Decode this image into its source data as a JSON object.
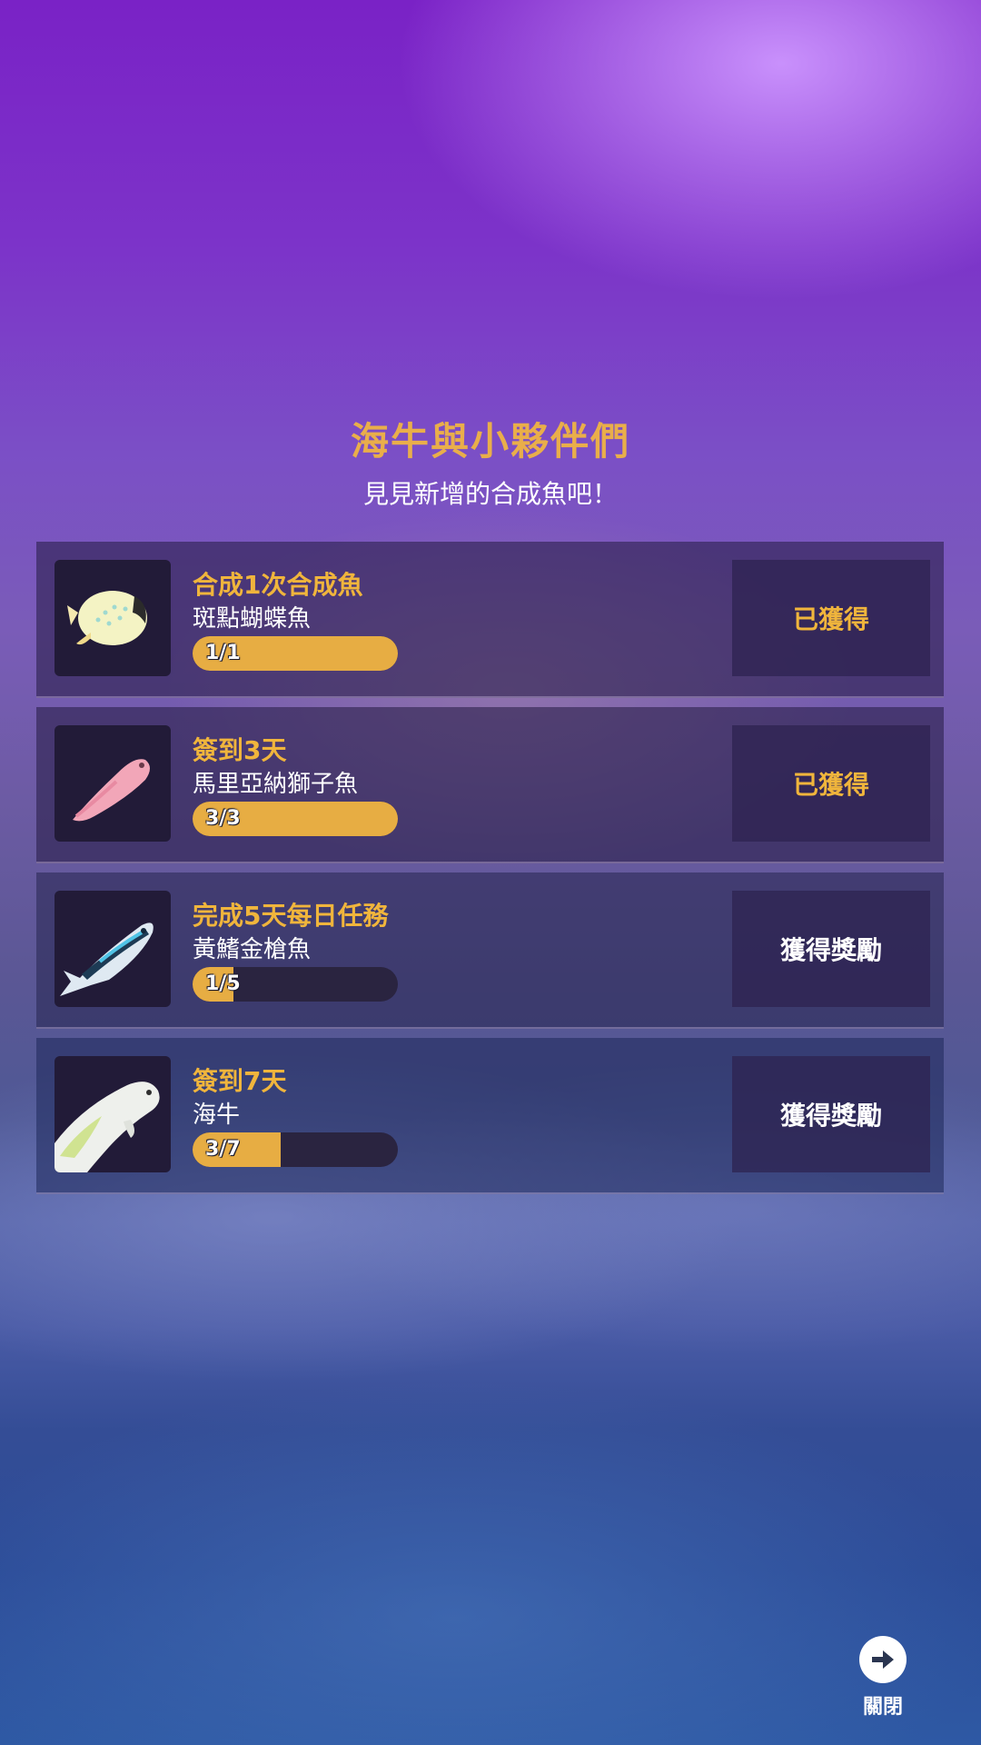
{
  "header": {
    "title": "海牛與小夥伴們",
    "subtitle": "見見新增的合成魚吧！"
  },
  "colors": {
    "accent_gold": "#e7ad43",
    "task_text": "#f0b53c",
    "panel_bg": "#2d2350"
  },
  "rewards": [
    {
      "task": "合成1次合成魚",
      "fish": "斑點蝴蝶魚",
      "progress_text": "1/1",
      "current": 1,
      "total": 1,
      "action_label": "已獲得",
      "claimed": true,
      "icon": "spotted-butterflyfish-icon"
    },
    {
      "task": "簽到3天",
      "fish": "馬里亞納獅子魚",
      "progress_text": "3/3",
      "current": 3,
      "total": 3,
      "action_label": "已獲得",
      "claimed": true,
      "icon": "mariana-snailfish-icon"
    },
    {
      "task": "完成5天每日任務",
      "fish": "黃鰭金槍魚",
      "progress_text": "1/5",
      "current": 1,
      "total": 5,
      "action_label": "獲得獎勵",
      "claimed": false,
      "icon": "yellowfin-tuna-icon"
    },
    {
      "task": "簽到7天",
      "fish": "海牛",
      "progress_text": "3/7",
      "current": 3,
      "total": 7,
      "action_label": "獲得獎勵",
      "claimed": false,
      "icon": "manatee-icon"
    }
  ],
  "close": {
    "label": "關閉",
    "icon": "arrow-right-icon"
  }
}
